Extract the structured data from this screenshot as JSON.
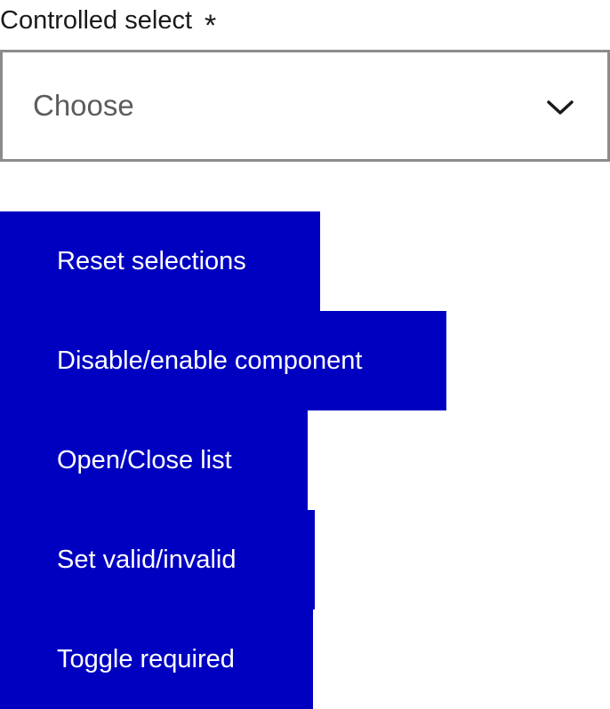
{
  "select": {
    "label": "Controlled select",
    "required_mark": "*",
    "value": "Choose",
    "icon": "chevron-down-icon"
  },
  "buttons": [
    {
      "label": "Reset selections"
    },
    {
      "label": "Disable/enable component"
    },
    {
      "label": "Open/Close list"
    },
    {
      "label": "Set valid/invalid"
    },
    {
      "label": "Toggle required"
    }
  ],
  "colors": {
    "button_bg": "#0000c0",
    "button_text": "#ffffff",
    "border": "#8c8c8c",
    "placeholder": "#5c5c5c"
  }
}
